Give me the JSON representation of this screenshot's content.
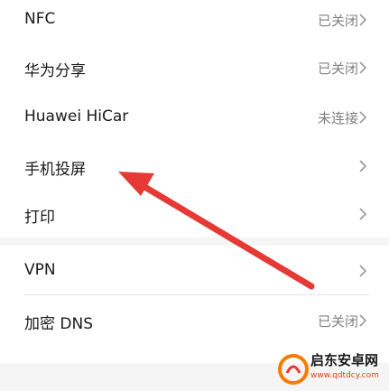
{
  "settings": {
    "rows": [
      {
        "label": "NFC",
        "value": "已关闭"
      },
      {
        "label": "华为分享",
        "value": "已关闭"
      },
      {
        "label": "Huawei HiCar",
        "value": "未连接"
      },
      {
        "label": "手机投屏",
        "value": ""
      },
      {
        "label": "打印",
        "value": ""
      }
    ],
    "rows2": [
      {
        "label": "VPN",
        "value": ""
      },
      {
        "label": "加密 DNS",
        "value": "已关闭"
      }
    ]
  },
  "annotation": {
    "arrow_color": "#e53935"
  },
  "watermark": {
    "title": "启东安卓网",
    "url": "www.qdtdcy.com"
  },
  "colors": {
    "text": "#1a1a1a",
    "secondary": "#808080",
    "background": "#f5f5f5"
  }
}
